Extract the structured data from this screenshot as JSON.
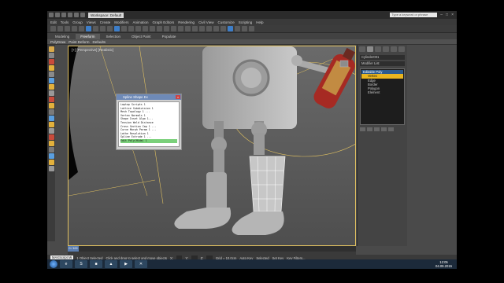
{
  "window": {
    "workspace": "Workspace: Default",
    "search_placeholder": "Type a keyword or phrase",
    "controls": [
      "–",
      "□",
      "×"
    ]
  },
  "menu": [
    "Edit",
    "Tools",
    "Group",
    "Views",
    "Create",
    "Modifiers",
    "Animation",
    "Graph Editors",
    "Rendering",
    "Civil View",
    "Customize",
    "Scripting",
    "Help"
  ],
  "ribbon": {
    "tabs": [
      "Modeling",
      "Freeform",
      "Selection",
      "Object Paint",
      "Populate"
    ],
    "active_tab": 1,
    "subtabs": [
      "PolyDraw",
      "Paint Deform",
      "Defaults"
    ]
  },
  "viewport": {
    "label": "[+] [Perspective] [Realistic]"
  },
  "script_window": {
    "title": "Spline Shape Ex",
    "lines": [
      "  Laptop Scripts 1",
      "  Lattice Subdivision 1",
      "  Mesh Topology 1 ...",
      "  Vertex Normals 1",
      "  Shape Inset Algo 1...",
      "  Tension Weld Distance",
      "  Cross Section Cap 1 ...",
      "  Curve Morph Param 1 ...",
      "  Lathe Resolution 1",
      "  Spline Extrude 1 ...",
      "  Edit Poly(Hide) 1"
    ],
    "highlight_index": 10
  },
  "command_panel": {
    "object_name": "Cylinder001",
    "modifier_list": "Modifier List",
    "stack": {
      "root": "Editable Poly",
      "items": [
        "Vertex",
        "Edge",
        "Border",
        "Polygon",
        "Element"
      ],
      "selected_index": 0
    }
  },
  "timeline": {
    "frame": "0 / 100"
  },
  "status": {
    "maxscript": "MAXScript Mi",
    "message": "1 Object Selected",
    "prompt": "Click and drag to select and move objects",
    "x_label": "X:",
    "y_label": "Y:",
    "z_label": "Z:",
    "grid": "Grid = 10.0cm",
    "autokey": "Auto Key",
    "selected": "Selected",
    "setkey": "Set Key",
    "keyfilters": "Key Filters..."
  },
  "taskbar": {
    "time": "12:05",
    "date": "04.09.2015",
    "apps": [
      "e",
      "S",
      "■",
      "▲",
      "▶",
      "✕"
    ]
  },
  "colors": {
    "accent": "#e9b520",
    "highlight": "#2d5b8e"
  }
}
